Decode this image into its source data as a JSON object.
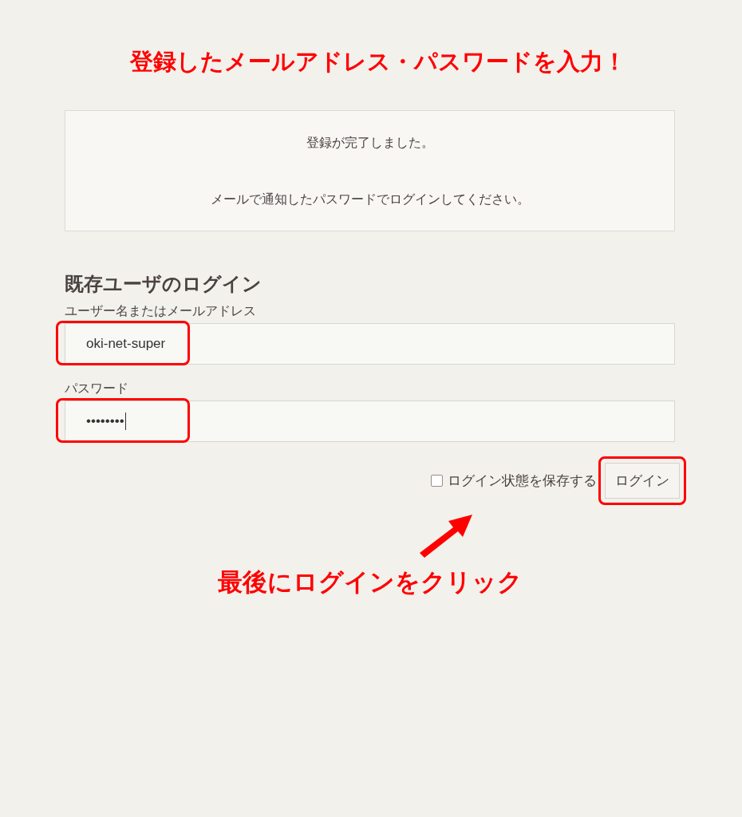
{
  "annotation_title": "登録したメールアドレス・パスワードを入力！",
  "notice": {
    "messages": [
      "登録が完了しました。",
      "メールで通知したパスワードでログインしてください。"
    ]
  },
  "login": {
    "heading": "既存ユーザのログイン",
    "fields": [
      {
        "label": "ユーザー名またはメールアドレス",
        "value": "oki-net-super",
        "highlighted": true,
        "caret": false
      },
      {
        "label": "パスワード",
        "value": "••••••••",
        "highlighted": true,
        "caret": true
      }
    ],
    "remember": {
      "label": "ログイン状態を保存する",
      "checked": false
    },
    "button": {
      "label": "ログイン",
      "highlighted": true
    }
  },
  "annotation_note": "最後にログインをクリック"
}
